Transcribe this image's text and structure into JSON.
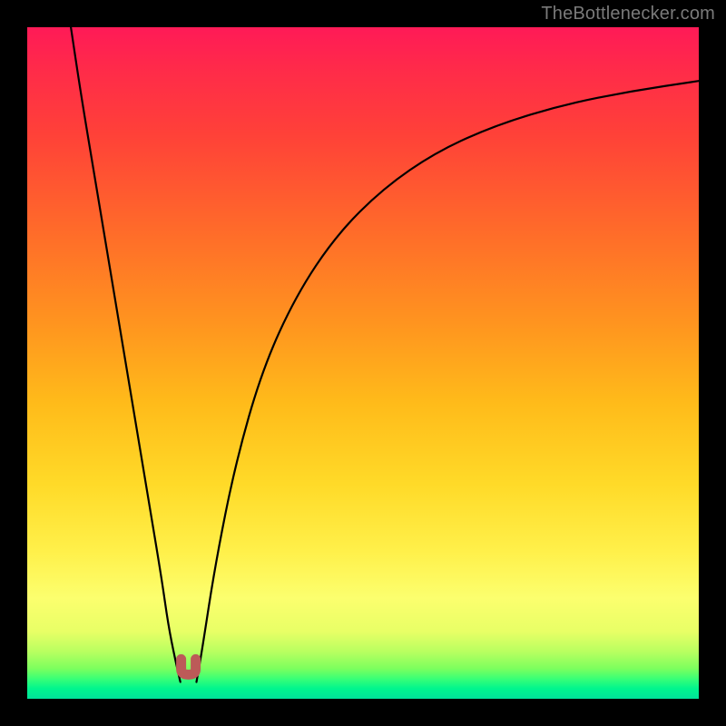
{
  "watermark": {
    "text": "TheBottlenecker.com"
  },
  "chart_data": {
    "type": "line",
    "title": "",
    "subtitle": "",
    "xlabel": "",
    "ylabel": "",
    "xlim": [
      0,
      100
    ],
    "ylim": [
      0,
      100
    ],
    "grid": false,
    "legend": false,
    "annotations": [],
    "note": "Two black V-curves over a vertical red→green gradient; a small rounded red-brown marker sits at the valley bottom near x≈24. No axis tick labels are shown in the image, so coordinates below are in percent of the plot area (0–100 each axis).",
    "valley_marker": {
      "x_pct": 24,
      "y_pct": 96,
      "color": "#bc5a58"
    },
    "series": [
      {
        "name": "left-arm",
        "x": [
          6.5,
          8,
          10,
          12,
          14,
          16,
          18,
          20,
          21,
          22,
          22.8
        ],
        "y": [
          100,
          90,
          78,
          66,
          54,
          42,
          30,
          18,
          11,
          6,
          2.5
        ]
      },
      {
        "name": "right-arm",
        "x": [
          25.2,
          26,
          28,
          31,
          35,
          40,
          46,
          53,
          61,
          70,
          80,
          90,
          100
        ],
        "y": [
          2.5,
          7,
          20,
          35,
          49,
          60,
          69,
          76,
          81.5,
          85.5,
          88.5,
          90.5,
          92
        ]
      }
    ]
  }
}
